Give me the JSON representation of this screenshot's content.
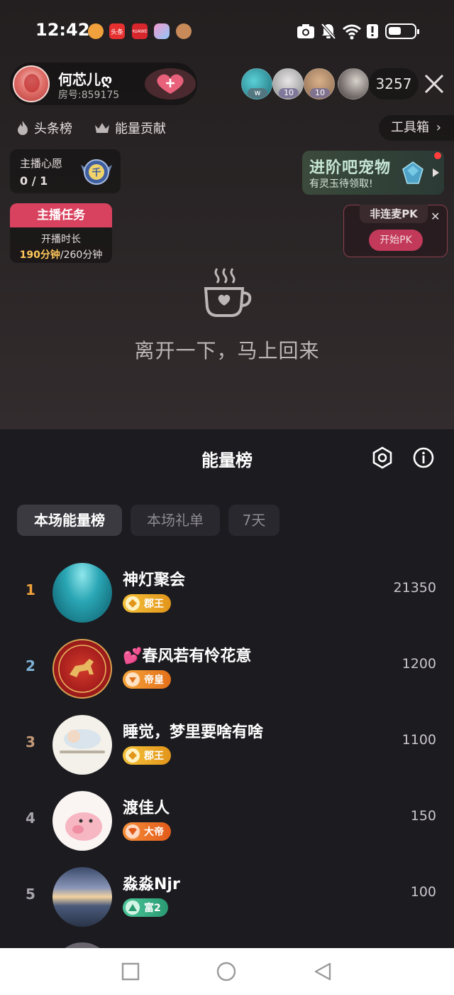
{
  "status_bar": {
    "time": "12:42",
    "app_icons": [
      {
        "name": "wechat-avatar-icon",
        "label": "",
        "color": "#f0a03c"
      },
      {
        "name": "toutiao-icon",
        "label": "头条",
        "color": "#e5302f"
      },
      {
        "name": "huawei-icon",
        "label": "HUAWEI",
        "color": "#d7262c"
      },
      {
        "name": "photos-icon",
        "label": "",
        "color": "#9a8ef0"
      },
      {
        "name": "profile-avatar-icon",
        "label": "",
        "color": "#c78a58"
      }
    ]
  },
  "host": {
    "name": "何芯儿ღ",
    "room": "房号:859175"
  },
  "viewers": {
    "levels": [
      "w",
      "10",
      "10",
      ""
    ],
    "count": "3257"
  },
  "links": {
    "headline": "头条榜",
    "contribution": "能量贡献",
    "toolbox": "工具箱"
  },
  "wish": {
    "title": "主播心愿",
    "count": "0 / 1",
    "badge_char": "千"
  },
  "pet_banner": {
    "title": "进阶吧宠物",
    "subtitle": "有灵玉待领取!"
  },
  "task": {
    "title": "主播任务",
    "label": "开播时长",
    "current": "190分钟",
    "total": "/260分钟"
  },
  "pk": {
    "title": "非连麦PK",
    "start": "开始PK"
  },
  "away_message": "离开一下，马上回来",
  "sheet": {
    "title": "能量榜",
    "tabs": [
      "本场能量榜",
      "本场礼单",
      "7天"
    ],
    "active_tab": 0
  },
  "ranking": [
    {
      "rank": "1",
      "name": "神灯聚会",
      "badge": "郡王",
      "score": "21350",
      "rank_color": "#f0a23c",
      "badge_color": "#f0b32a"
    },
    {
      "rank": "2",
      "name": "💕春风若有怜花意",
      "badge": "帝皇",
      "score": "1200",
      "rank_color": "#7eb2d6",
      "badge_color": "#f08a2a"
    },
    {
      "rank": "3",
      "name": "睡觉，梦里要啥有啥",
      "badge": "郡王",
      "score": "1100",
      "rank_color": "#c49a78",
      "badge_color": "#f0b32a"
    },
    {
      "rank": "4",
      "name": "渡佳人",
      "badge": "大帝",
      "score": "150",
      "rank_color": "#a7a4ab",
      "badge_color": "#f07a2a"
    },
    {
      "rank": "5",
      "name": "淼淼Njr",
      "badge": "富2",
      "score": "100",
      "rank_color": "#a7a4ab",
      "badge_color": "#3bb38a"
    }
  ]
}
